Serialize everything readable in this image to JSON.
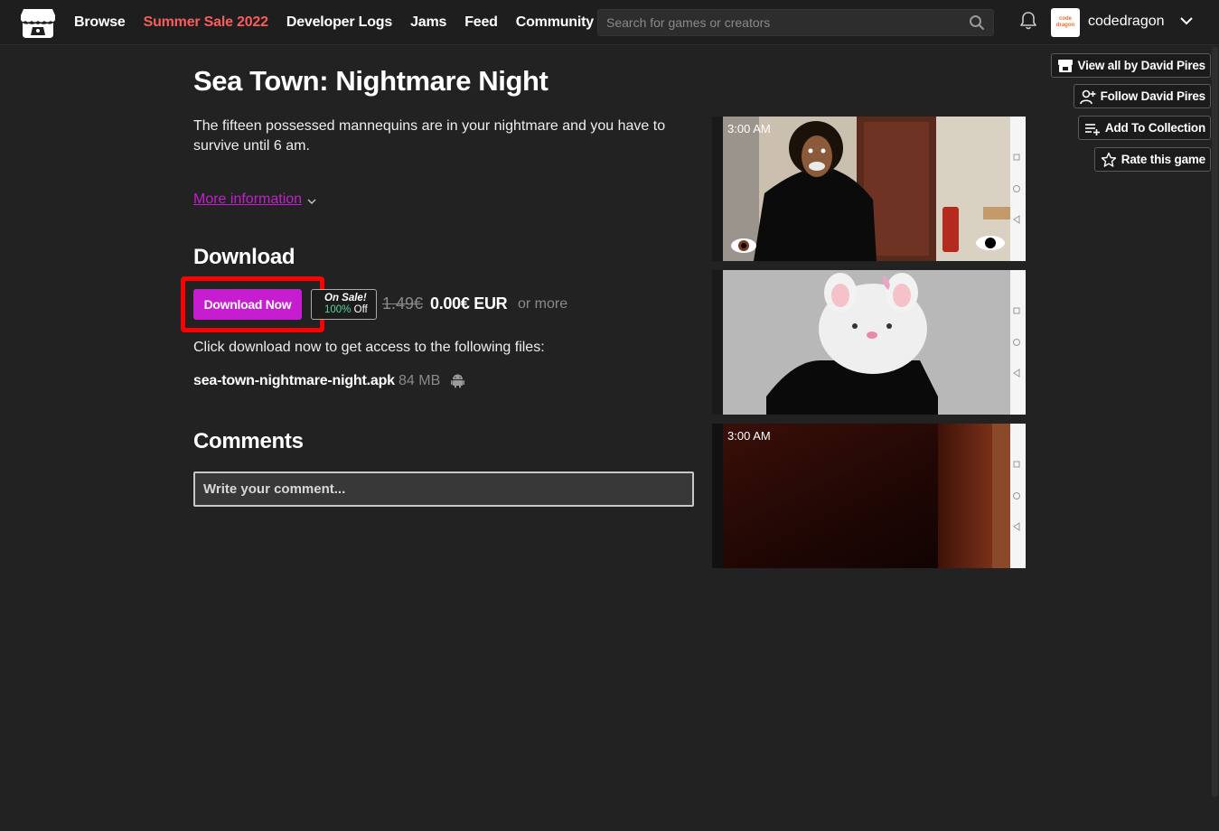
{
  "header": {
    "nav": [
      "Browse",
      "Summer Sale 2022",
      "Developer Logs",
      "Jams",
      "Feed",
      "Community"
    ],
    "search_placeholder": "Search for games or creators",
    "avatar_text": "code dragon",
    "username": "codedragon"
  },
  "sidebar": {
    "view_all": "View all by David Pires",
    "follow": "Follow David Pires",
    "add_collection": "Add To Collection",
    "rate": "Rate this game"
  },
  "game": {
    "title": "Sea Town: Nightmare Night",
    "description": "The fifteen possessed mannequins are in your nightmare and you have to survive until 6 am.",
    "more_info": "More information"
  },
  "download": {
    "heading": "Download",
    "button_label": "Download Now",
    "sale_line1": "On Sale!",
    "sale_pct": "100%",
    "sale_off": "Off",
    "price_old": "1.49€",
    "price_new": "0.00€ EUR",
    "or_more": "or more",
    "files_text": "Click download now to get access to the following files:",
    "file_name": "sea-town-nightmare-night.apk",
    "file_size": "84 MB"
  },
  "comments": {
    "heading": "Comments",
    "placeholder": "Write your comment..."
  },
  "screenshots": [
    {
      "time": "3:00 AM"
    },
    {
      "time": ""
    },
    {
      "time": "3:00 AM"
    }
  ],
  "colors": {
    "accent": "#c71dd0",
    "sale_red": "#fa5c5c",
    "sale_green": "#5bd39b",
    "highlight": "#ff0000",
    "background": "#222222"
  }
}
